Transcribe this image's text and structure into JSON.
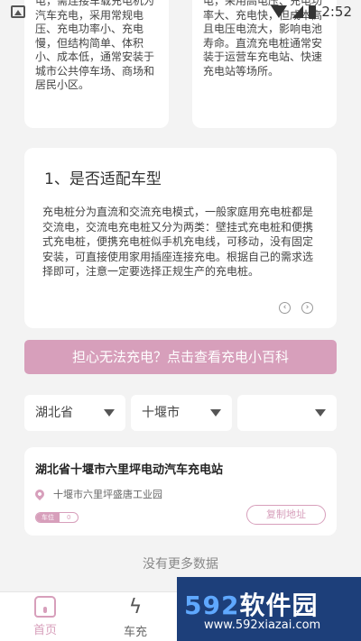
{
  "status_bar": {
    "time": "2:52"
  },
  "top_cards": {
    "left_text": "电，需连接车载充电机为汽车充电，采用常规电压、充电功率小、充电慢，但结构简单、体积小、成本低，通常安装于城市公共停车场、商场和居民小区。",
    "right_text": "电，采用高电压、充电功率大、充电快，但成本高且电压电流大，影响电池寿命。直流充电桩通常安装于运营车充电站、快速充电站等场所。"
  },
  "info_card": {
    "title": "1、是否适配车型",
    "body": "充电桩分为直流和交流充电模式，一般家庭用充电桩都是交流电，交流电充电桩又分为两类：壁挂式充电桩和便携式充电桩，便携充电桩似手机充电线，可移动，没有固定安装，可直接使用家用插座连接充电。根据自己的需求选择即可，注意一定要选择正规生产的充电桩。",
    "prev_symbol": "‹",
    "next_symbol": "›"
  },
  "banner": {
    "label": "担心无法充电？点击查看充电小百科"
  },
  "filters": {
    "province": "湖北省",
    "city": "十堰市",
    "district": ""
  },
  "station": {
    "name": "湖北省十堰市六里坪电动汽车充电站",
    "address": "十堰市六里坪盛唐工业园",
    "badge_label": "车位",
    "badge_value": "0",
    "copy_label": "复制地址"
  },
  "list_footer": "没有更多数据",
  "tabs": [
    {
      "label": "首页"
    },
    {
      "label": "车充"
    }
  ],
  "watermark": {
    "logo_num": "592",
    "logo_text": "软件园",
    "url": "www.592xiazai.com"
  },
  "colors": {
    "accent": "#d79fbb",
    "background": "#f3f3f3"
  }
}
